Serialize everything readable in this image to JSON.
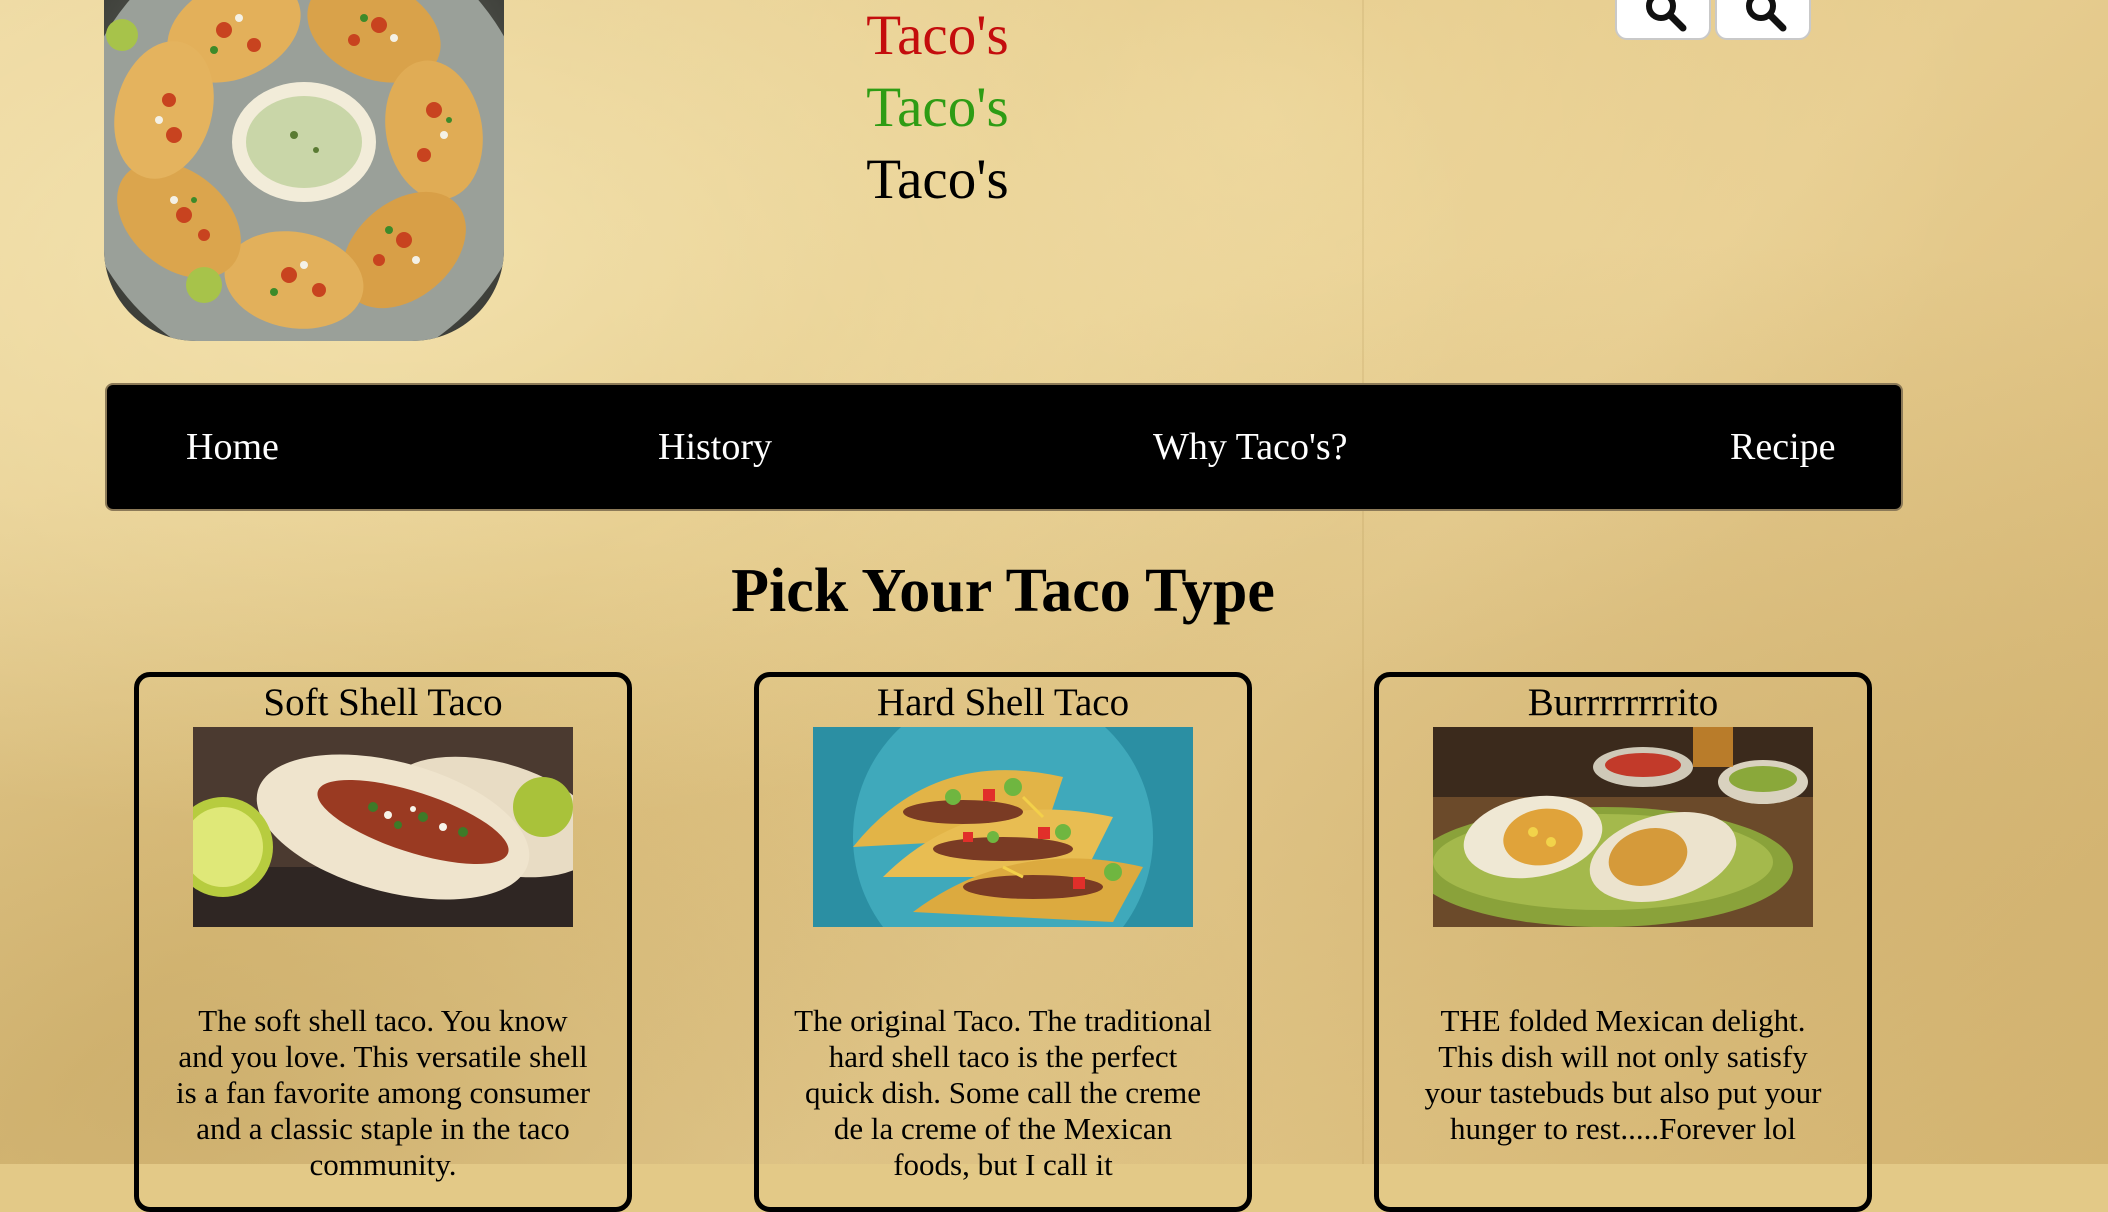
{
  "header": {
    "logo_alt": "Platter of tacos with dip",
    "titles": [
      "Taco's",
      "Taco's",
      "Taco's"
    ],
    "title_colors": [
      "#c40d0d",
      "#2e9c14",
      "#000000"
    ]
  },
  "search_buttons": [
    {
      "icon": "magnifier-icon"
    },
    {
      "icon": "magnifier-icon"
    }
  ],
  "nav": {
    "items": [
      "Home",
      "History",
      "Why Taco's?",
      "Recipe"
    ]
  },
  "main": {
    "heading": "Pick Your Taco Type",
    "cards": [
      {
        "title": "Soft Shell Taco",
        "image": "soft-shell-taco-photo",
        "description": "The soft shell taco. You know and you love. This versatile shell is a fan favorite among consumer and a classic staple in the taco community."
      },
      {
        "title": "Hard Shell Taco",
        "image": "hard-shell-taco-photo",
        "description": "The original Taco. The traditional hard shell taco is the perfect quick dish. Some call the creme de la creme of the Mexican foods, but I call it"
      },
      {
        "title": "Burrrrrrrrito",
        "image": "burrito-photo",
        "description": "THE folded Mexican delight. This dish will not only satisfy your tastebuds but also put your hunger to rest.....Forever lol"
      }
    ]
  }
}
